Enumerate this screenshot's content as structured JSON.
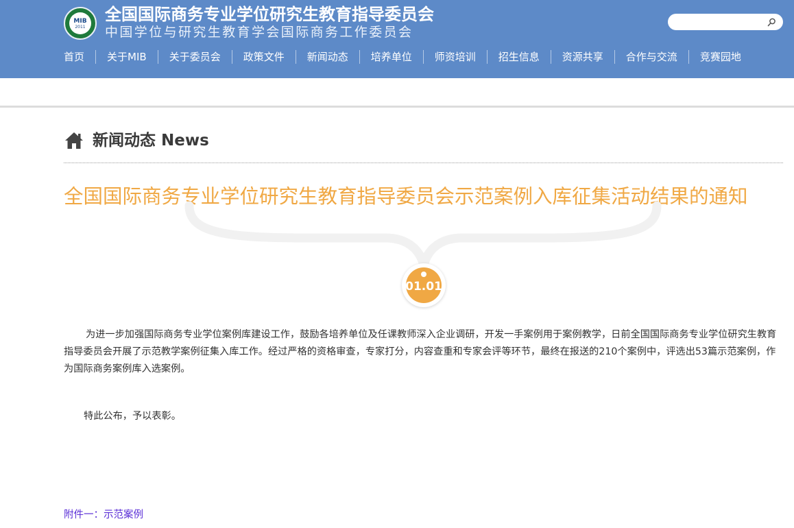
{
  "header": {
    "logo": {
      "text": "MIB",
      "year": "2011"
    },
    "title": "全国国际商务专业学位研究生教育指导委员会",
    "subtitle": "中国学位与研究生教育学会国际商务工作委员会",
    "search": {
      "value": "",
      "placeholder": ""
    },
    "nav": [
      {
        "label": "首页"
      },
      {
        "label": "关于MIB"
      },
      {
        "label": "关于委员会"
      },
      {
        "label": "政策文件"
      },
      {
        "label": "新闻动态"
      },
      {
        "label": "培养单位"
      },
      {
        "label": "师资培训"
      },
      {
        "label": "招生信息"
      },
      {
        "label": "资源共享"
      },
      {
        "label": "合作与交流"
      },
      {
        "label": "竞赛园地"
      }
    ]
  },
  "section": {
    "title": "新闻动态 News"
  },
  "article": {
    "title": "全国国际商务专业学位研究生教育指导委员会示范案例入库征集活动结果的通知",
    "date": "01.01",
    "paragraphs": [
      "为进一步加强国际商务专业学位案例库建设工作，鼓励各培养单位及任课教师深入企业调研，开发一手案例用于案例教学，日前全国国际商务专业学位研究生教育指导委员会开展了示范教学案例征集入库工作。经过严格的资格审查，专家打分，内容查重和专家会评等环节，最终在报送的210个案例中，评选出53篇示范案例，作为国际商务案例库入选案例。",
      "特此公布，予以表彰。"
    ],
    "attachment": "附件一：示范案例"
  },
  "colors": {
    "header_bg": "#5d8ac8",
    "title_accent": "#f0a844",
    "link": "#5a2ed6",
    "logo_green": "#1f7a3c"
  }
}
